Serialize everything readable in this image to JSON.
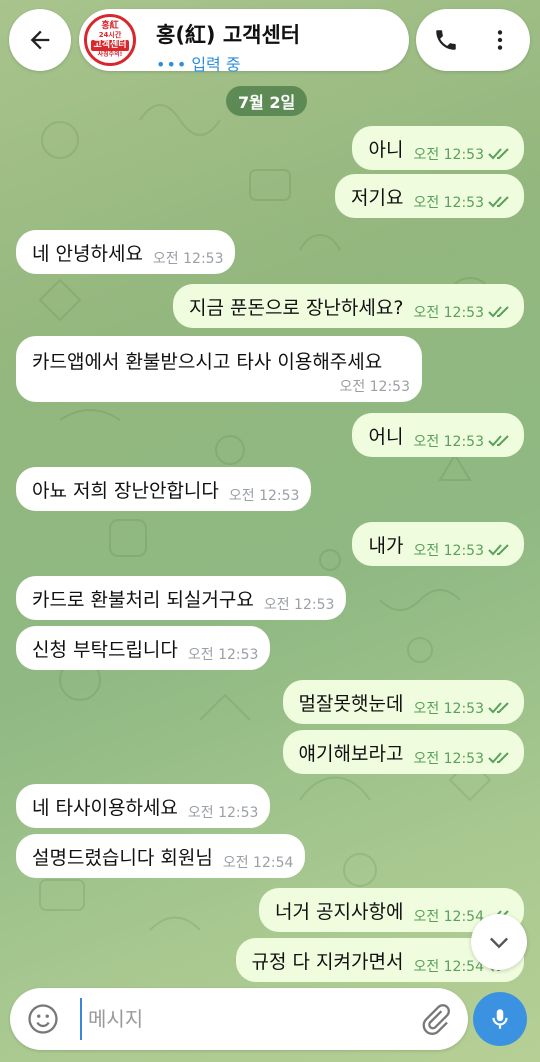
{
  "header": {
    "contact_name": "홍(紅) 고객센터",
    "status_text": "입력 중",
    "avatar": {
      "line1": "홍紅",
      "line2": "24시간",
      "line3": "고객센터",
      "line4": "사칭주의!"
    }
  },
  "date_chip": "7월 2일",
  "messages": [
    {
      "dir": "out",
      "text": "아니",
      "time": "오전 12:53",
      "read": true
    },
    {
      "dir": "out",
      "text": "저기요",
      "time": "오전 12:53",
      "read": true
    },
    {
      "dir": "in",
      "text": "네 안녕하세요",
      "time": "오전 12:53"
    },
    {
      "dir": "out",
      "text": "지금 푼돈으로 장난하세요?",
      "time": "오전 12:53",
      "read": true
    },
    {
      "dir": "in",
      "text": "카드앱에서 환불받으시고 타사 이용해주세요",
      "time": "오전 12:53"
    },
    {
      "dir": "out",
      "text": "어니",
      "time": "오전 12:53",
      "read": true
    },
    {
      "dir": "in",
      "text": "아뇨 저희 장난안합니다",
      "time": "오전 12:53"
    },
    {
      "dir": "out",
      "text": "내가",
      "time": "오전 12:53",
      "read": true
    },
    {
      "dir": "in",
      "text": "카드로 환불처리 되실거구요",
      "time": "오전 12:53"
    },
    {
      "dir": "in",
      "text": "신청 부탁드립니다",
      "time": "오전 12:53"
    },
    {
      "dir": "out",
      "text": "멀잘못햇눈데",
      "time": "오전 12:53",
      "read": true
    },
    {
      "dir": "out",
      "text": "얘기해보라고",
      "time": "오전 12:53",
      "read": true
    },
    {
      "dir": "in",
      "text": "네 타사이용하세요",
      "time": "오전 12:53"
    },
    {
      "dir": "in",
      "text": "설명드렸습니다 회원님",
      "time": "오전 12:54"
    },
    {
      "dir": "out",
      "text": "너거 공지사항에",
      "time": "오전 12:54",
      "read": true
    },
    {
      "dir": "out",
      "text": "규정 다 지켜가면서",
      "time": "오전 12:54",
      "read": true
    }
  ],
  "composer": {
    "placeholder": "메시지"
  },
  "icons": {
    "back": "arrow-left-icon",
    "phone": "phone-icon",
    "menu": "more-vert-icon",
    "emoji": "smiley-icon",
    "attach": "paperclip-icon",
    "mic": "microphone-icon",
    "scroll_down": "chevron-down-icon",
    "read_receipt": "double-check-icon"
  },
  "colors": {
    "outgoing_bubble": "#effdde",
    "incoming_bubble": "#ffffff",
    "read_check": "#5aa05c",
    "status_blue": "#2f8fd8",
    "mic_button": "#3b92e0",
    "date_chip": "#4c7a48"
  }
}
